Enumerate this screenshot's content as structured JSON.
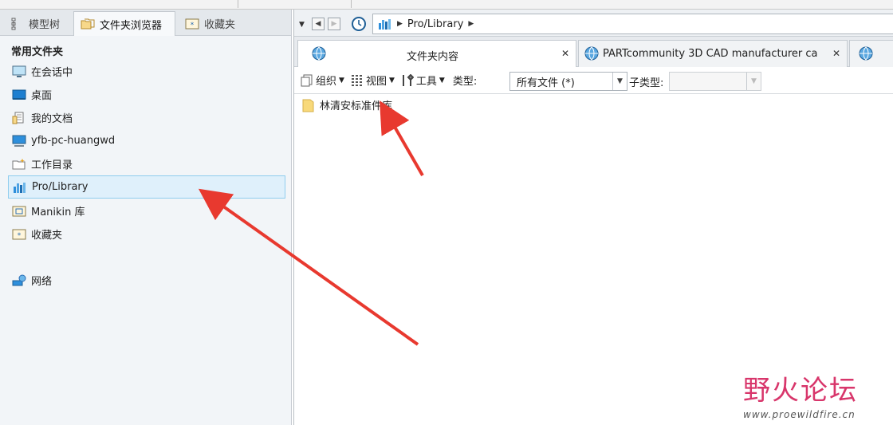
{
  "left_panel": {
    "tabs": [
      {
        "label": "模型树",
        "icon": "model-tree-icon"
      },
      {
        "label": "文件夹浏览器",
        "icon": "folder-browser-icon"
      },
      {
        "label": "收藏夹",
        "icon": "favorites-icon"
      }
    ],
    "section_title": "常用文件夹",
    "items": [
      {
        "label": "在会话中",
        "icon": "session-monitor-icon"
      },
      {
        "label": "桌面",
        "icon": "desktop-icon"
      },
      {
        "label": "我的文档",
        "icon": "documents-icon"
      },
      {
        "label": "yfb-pc-huangwd",
        "icon": "computer-icon"
      },
      {
        "label": "工作目录",
        "icon": "working-directory-icon"
      },
      {
        "label": "Pro/Library",
        "icon": "pro-library-icon",
        "selected": true
      },
      {
        "label": "Manikin 库",
        "icon": "manikin-library-icon"
      },
      {
        "label": "收藏夹",
        "icon": "favorites-folder-icon"
      },
      {
        "label": "网络",
        "icon": "network-icon"
      }
    ]
  },
  "address_bar": {
    "path": "Pro/Library"
  },
  "tabs": [
    {
      "label": "文件夹内容",
      "active": true
    },
    {
      "label": "PARTcommunity 3D CAD manufacturer ca",
      "active": false
    }
  ],
  "toolbar": {
    "organize_label": "组织",
    "views_label": "视图",
    "tools_label": "工具",
    "type_label": "类型:",
    "type_value": "所有文件 (*)",
    "subtype_label": "子类型:"
  },
  "files": [
    {
      "name": "林清安标准件库",
      "icon": "folder-icon"
    }
  ],
  "watermark": {
    "title": "野火论坛",
    "url": "www.proewildfire.cn"
  },
  "colors": {
    "selection_bg": "#dff0fb",
    "selection_border": "#90cdee",
    "arrow": "#e8392f",
    "watermark_accent": "#d8366b"
  }
}
